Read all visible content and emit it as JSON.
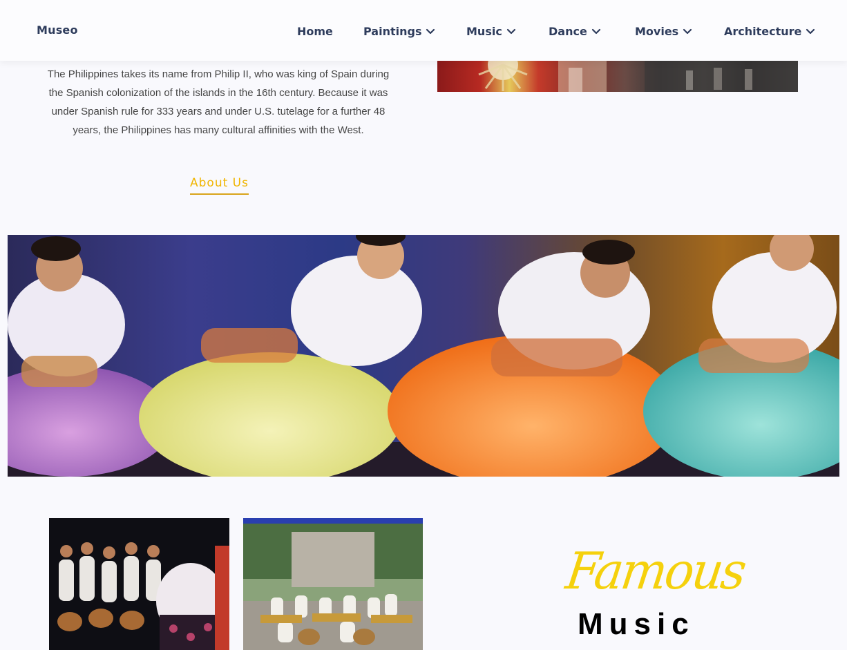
{
  "header": {
    "logo": "Museo",
    "nav": [
      {
        "label": "Home",
        "has_dropdown": false
      },
      {
        "label": "Paintings",
        "has_dropdown": true
      },
      {
        "label": "Music",
        "has_dropdown": true
      },
      {
        "label": "Dance",
        "has_dropdown": true
      },
      {
        "label": "Movies",
        "has_dropdown": true
      },
      {
        "label": "Architecture",
        "has_dropdown": true
      }
    ]
  },
  "intro": {
    "paragraph": "The Philippines takes its name from Philip II, who was king of Spain during the Spanish colonization of the islands in the 16th century. Because it was under Spanish rule for 333 years and under U.S. tutelage for a further 48 years, the Philippines has many cultural affinities with the West.",
    "about_label": "About Us"
  },
  "music_section": {
    "heading_script": "Famous",
    "heading_main": "Music"
  },
  "colors": {
    "nav_text": "#2e3c5c",
    "accent_gold": "#f0b500",
    "heading_yellow": "#f5d10d",
    "page_bg": "#f9f9fd"
  },
  "icons": {
    "dropdown": "chevron-down-icon"
  }
}
